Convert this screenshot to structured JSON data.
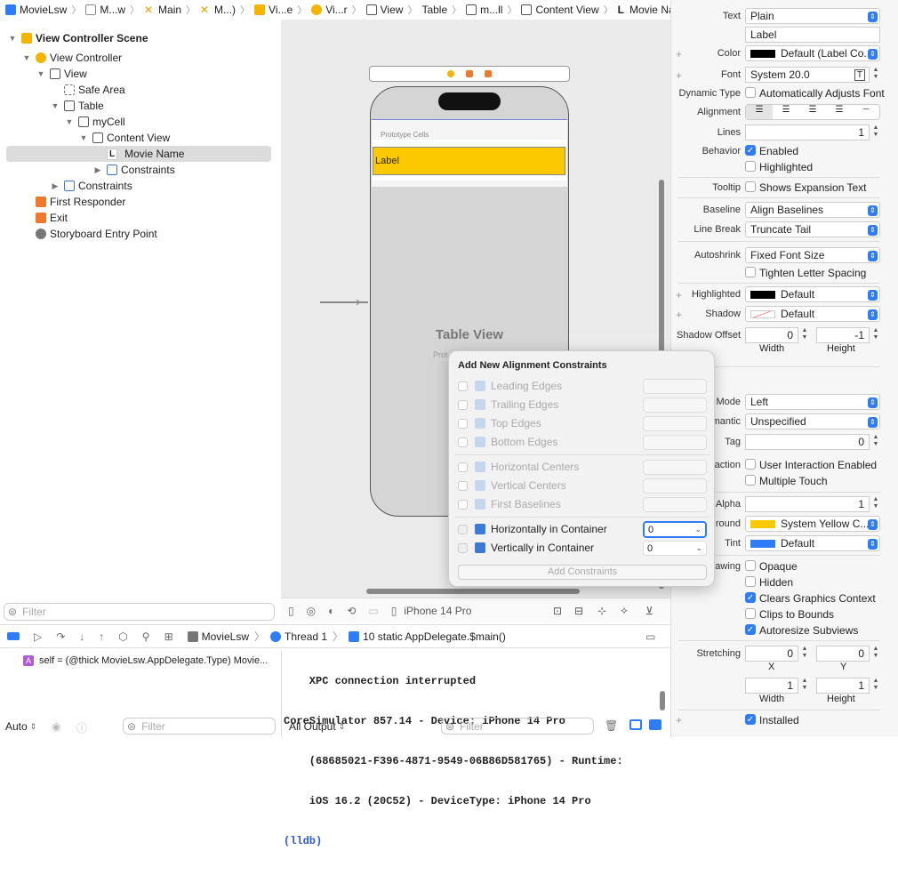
{
  "breadcrumb": [
    "MovieLsw",
    "M...w",
    "Main",
    "M...)",
    "Vi...e",
    "Vi...r",
    "View",
    "Table",
    "m...ll",
    "Content View",
    "Movie Name"
  ],
  "navigator": {
    "items": [
      {
        "label": "View Controller Scene",
        "bold": true
      },
      {
        "label": "View Controller"
      },
      {
        "label": "View"
      },
      {
        "label": "Safe Area"
      },
      {
        "label": "Table"
      },
      {
        "label": "myCell"
      },
      {
        "label": "Content View"
      },
      {
        "label": "Movie Name",
        "selected": true
      },
      {
        "label": "Constraints"
      },
      {
        "label": "Constraints"
      },
      {
        "label": "First Responder"
      },
      {
        "label": "Exit"
      },
      {
        "label": "Storyboard Entry Point"
      }
    ],
    "filter_placeholder": "Filter"
  },
  "canvas": {
    "prototype_cells": "Prototype Cells",
    "label_text": "Label",
    "table_view": "Table View",
    "table_sub": "Prot",
    "device": "iPhone 14 Pro"
  },
  "popover": {
    "title": "Add New Alignment Constraints",
    "items": [
      "Leading Edges",
      "Trailing Edges",
      "Top Edges",
      "Bottom Edges",
      "Horizontal Centers",
      "Vertical Centers",
      "First Baselines"
    ],
    "active": [
      {
        "label": "Horizontally in Container",
        "value": "0"
      },
      {
        "label": "Vertically in Container",
        "value": "0"
      }
    ],
    "button": "Add Constraints"
  },
  "inspector": {
    "text_label": "Text",
    "text_value": "Plain",
    "text_field": "Label",
    "color_label": "Color",
    "color_value": "Default (Label Co...",
    "font_label": "Font",
    "font_value": "System 20.0",
    "dynamic_label": "Dynamic Type",
    "dynamic_value": "Automatically Adjusts Font",
    "alignment_label": "Alignment",
    "lines_label": "Lines",
    "lines_value": "1",
    "behavior_label": "Behavior",
    "enabled": "Enabled",
    "highlighted_chk": "Highlighted",
    "tooltip_label": "Tooltip",
    "tooltip_value": "Shows Expansion Text",
    "baseline_label": "Baseline",
    "baseline_value": "Align Baselines",
    "linebreak_label": "Line Break",
    "linebreak_value": "Truncate Tail",
    "autoshrink_label": "Autoshrink",
    "autoshrink_value": "Fixed Font Size",
    "tighten": "Tighten Letter Spacing",
    "highlighted_label": "Highlighted",
    "highlighted_value": "Default",
    "shadow_label": "Shadow",
    "shadow_value": "Default",
    "shadow_offset_label": "Shadow Offset",
    "shadow_w": "0",
    "shadow_h": "-1",
    "width": "Width",
    "height": "Height",
    "mode_label": "Mode",
    "mode_value": "Left",
    "semantic_label": "mantic",
    "semantic_value": "Unspecified",
    "tag_label": "Tag",
    "tag_value": "0",
    "interaction_label": "action",
    "user_interaction": "User Interaction Enabled",
    "multiple_touch": "Multiple Touch",
    "alpha_label": "Alpha",
    "alpha_value": "1",
    "background_label": "round",
    "background_value": "System Yellow C...",
    "tint_label": "Tint",
    "tint_value": "Default",
    "drawing_label": "rawing",
    "opaque": "Opaque",
    "hidden": "Hidden",
    "clears": "Clears Graphics Context",
    "clips": "Clips to Bounds",
    "autoresize": "Autoresize Subviews",
    "stretching_label": "Stretching",
    "sx": "0",
    "sy": "0",
    "x": "X",
    "y": "Y",
    "sw": "1",
    "sh": "1",
    "installed": "Installed"
  },
  "debug": {
    "app": "MovieLsw",
    "thread": "Thread 1",
    "frame": "10 static AppDelegate.$main()",
    "variable": "self = (@thick MovieLsw.AppDelegate.Type) Movie...",
    "console": [
      "    XPC connection interrupted",
      "CoreSimulator 857.14 - Device: iPhone 14 Pro",
      "    (68685021-F396-4871-9549-06B86D581765) - Runtime:",
      "    iOS 16.2 (20C52) - DeviceType: iPhone 14 Pro"
    ],
    "prompt": "(lldb)",
    "auto": "Auto",
    "all_output": "All Output",
    "filter": "Filter"
  },
  "colors": {
    "accent": "#2f7df6",
    "yellow": "#fcc800",
    "selection": "#dcdcdc"
  }
}
